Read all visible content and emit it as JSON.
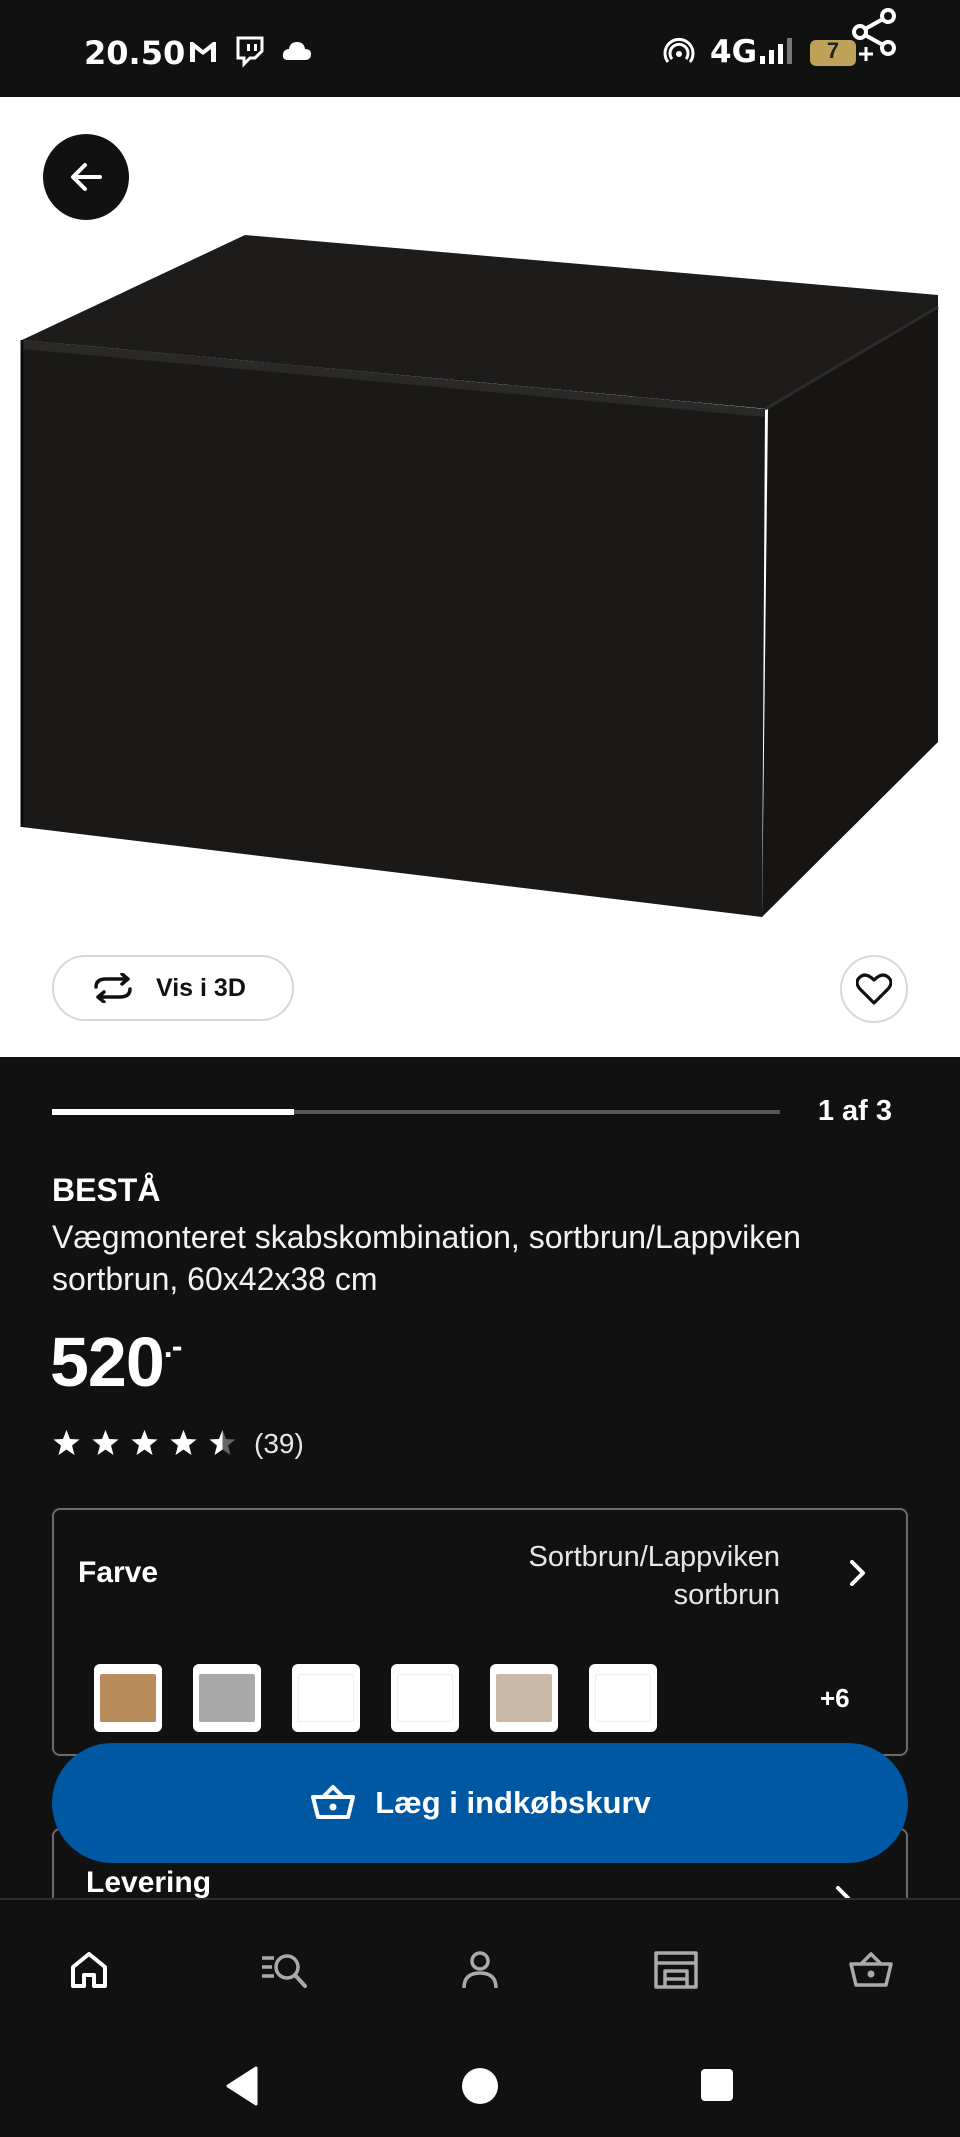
{
  "status_bar": {
    "time": "20.50",
    "icons": [
      "gmail-icon",
      "twitch-icon",
      "cloud-icon"
    ],
    "network": "4G",
    "battery": "7"
  },
  "hero": {
    "view_3d_label": "Vis i 3D"
  },
  "carousel": {
    "page_indicator": "1 af 3",
    "progress_fraction": 0.333
  },
  "product": {
    "name": "BESTÅ",
    "description": "Vægmonteret skabskombination, sortbrun/Lappviken sortbrun, 60x42x38 cm",
    "price": "520",
    "price_suffix": ".-",
    "rating": 4.5,
    "rating_count": "(39)"
  },
  "color_section": {
    "label": "Farve",
    "value": "Sortbrun/Lappviken sortbrun",
    "more": "+6",
    "swatches": [
      "#b78b5c",
      "#a9a9a9",
      "#ffffff",
      "#ffffff",
      "#c9b9a6",
      "#ffffff"
    ]
  },
  "cta": {
    "label": "Læg i indkøbskurv"
  },
  "delivery": {
    "label": "Levering"
  },
  "bottom_nav": [
    "home-icon",
    "search-icon",
    "account-icon",
    "store-icon",
    "basket-icon"
  ],
  "colors": {
    "background": "#111111",
    "cta_blue": "#0058a3",
    "card_border": "#6b6b6b"
  }
}
